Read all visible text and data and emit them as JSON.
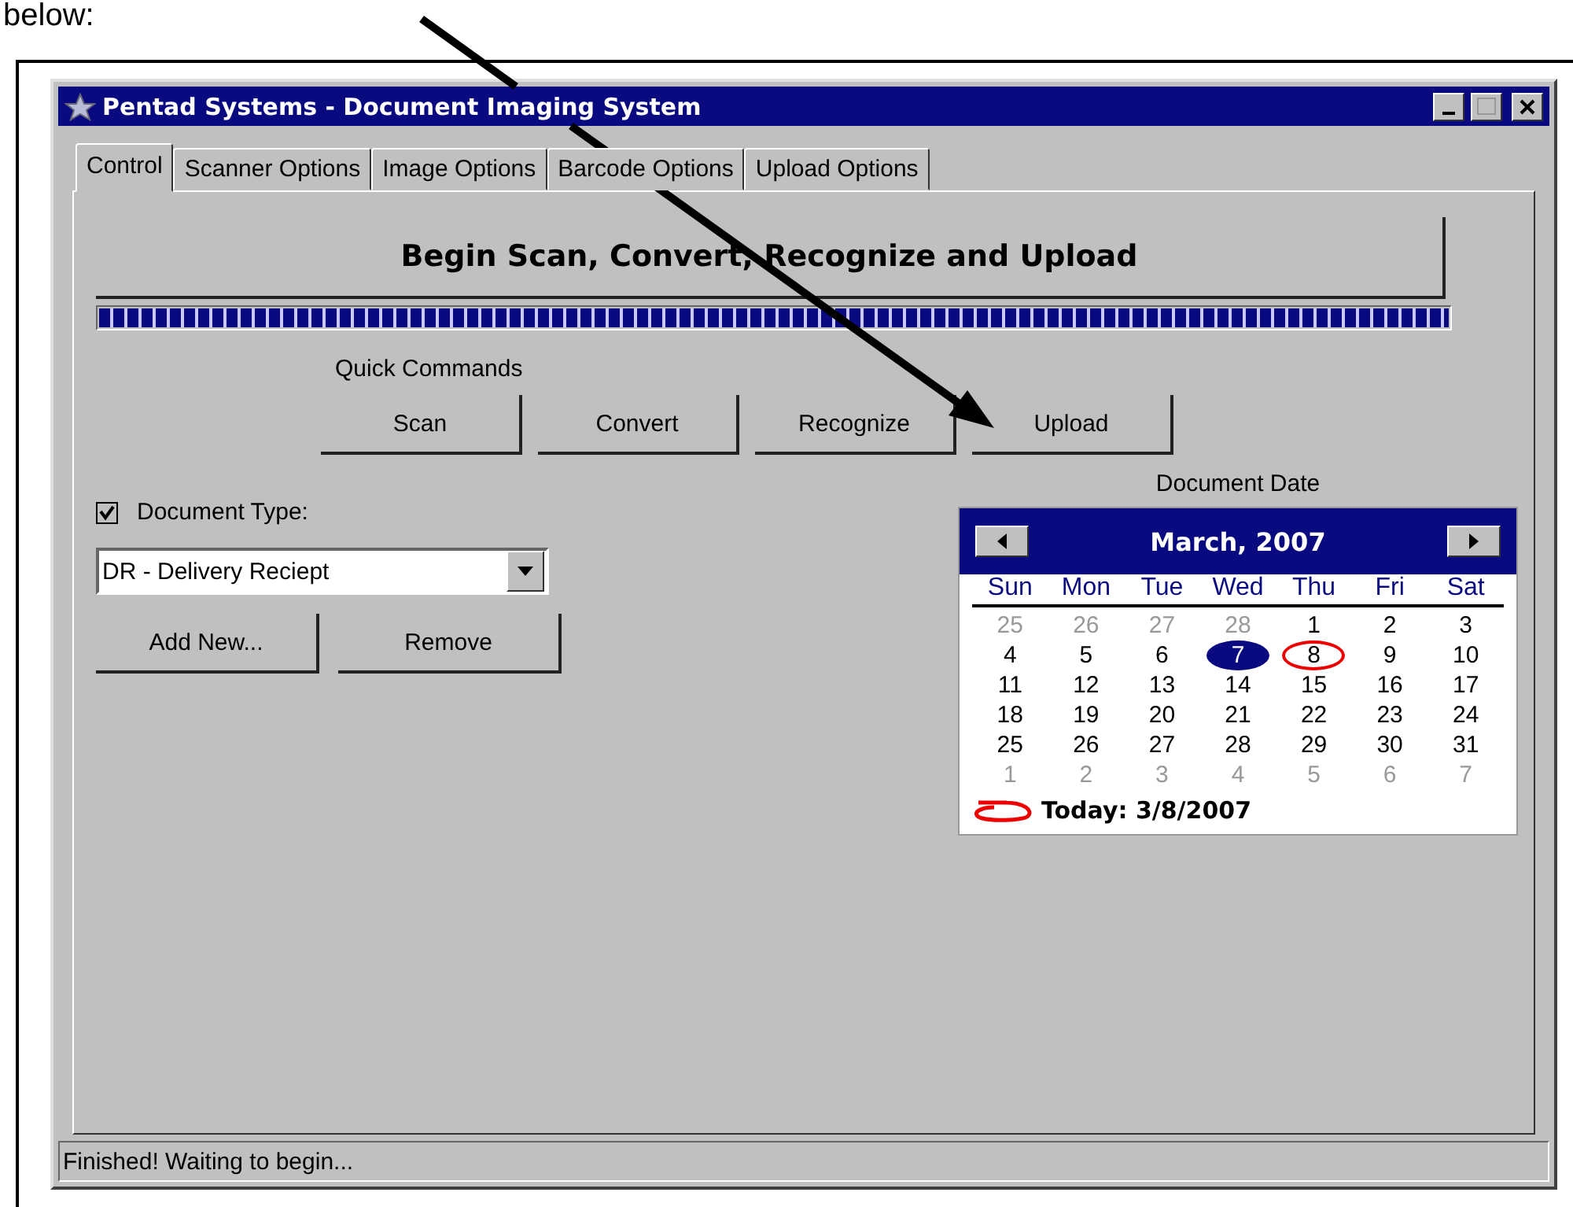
{
  "document_text": "below:",
  "window": {
    "title": "Pentad Systems - Document Imaging System"
  },
  "tabs": [
    {
      "label": "Control",
      "selected": true
    },
    {
      "label": "Scanner Options",
      "selected": false
    },
    {
      "label": "Image Options",
      "selected": false
    },
    {
      "label": "Barcode Options",
      "selected": false
    },
    {
      "label": "Upload Options",
      "selected": false
    }
  ],
  "main_button": "Begin Scan, Convert, Recognize and Upload",
  "progress": {
    "level": 1
  },
  "quick_commands": {
    "label": "Quick Commands",
    "buttons": [
      "Scan",
      "Convert",
      "Recognize",
      "Upload"
    ]
  },
  "document_type": {
    "label": "Document Type:",
    "checked": true,
    "value": "DR - Delivery Reciept",
    "buttons": [
      "Add New...",
      "Remove"
    ]
  },
  "document_date": {
    "label": "Document Date",
    "month": "March, 2007",
    "weekdays": [
      "Sun",
      "Mon",
      "Tue",
      "Wed",
      "Thu",
      "Fri",
      "Sat"
    ],
    "days": [
      {
        "text": "25",
        "muted": true,
        "selected": false,
        "today": false
      },
      {
        "text": "26",
        "muted": true,
        "selected": false,
        "today": false
      },
      {
        "text": "27",
        "muted": true,
        "selected": false,
        "today": false
      },
      {
        "text": "28",
        "muted": true,
        "selected": false,
        "today": false
      },
      {
        "text": "1",
        "muted": false,
        "selected": false,
        "today": false
      },
      {
        "text": "2",
        "muted": false,
        "selected": false,
        "today": false
      },
      {
        "text": "3",
        "muted": false,
        "selected": false,
        "today": false
      },
      {
        "text": "4",
        "muted": false,
        "selected": false,
        "today": false
      },
      {
        "text": "5",
        "muted": false,
        "selected": false,
        "today": false
      },
      {
        "text": "6",
        "muted": false,
        "selected": false,
        "today": false
      },
      {
        "text": "7",
        "muted": false,
        "selected": true,
        "today": false
      },
      {
        "text": "8",
        "muted": false,
        "selected": false,
        "today": true
      },
      {
        "text": "9",
        "muted": false,
        "selected": false,
        "today": false
      },
      {
        "text": "10",
        "muted": false,
        "selected": false,
        "today": false
      },
      {
        "text": "11",
        "muted": false,
        "selected": false,
        "today": false
      },
      {
        "text": "12",
        "muted": false,
        "selected": false,
        "today": false
      },
      {
        "text": "13",
        "muted": false,
        "selected": false,
        "today": false
      },
      {
        "text": "14",
        "muted": false,
        "selected": false,
        "today": false
      },
      {
        "text": "15",
        "muted": false,
        "selected": false,
        "today": false
      },
      {
        "text": "16",
        "muted": false,
        "selected": false,
        "today": false
      },
      {
        "text": "17",
        "muted": false,
        "selected": false,
        "today": false
      },
      {
        "text": "18",
        "muted": false,
        "selected": false,
        "today": false
      },
      {
        "text": "19",
        "muted": false,
        "selected": false,
        "today": false
      },
      {
        "text": "20",
        "muted": false,
        "selected": false,
        "today": false
      },
      {
        "text": "21",
        "muted": false,
        "selected": false,
        "today": false
      },
      {
        "text": "22",
        "muted": false,
        "selected": false,
        "today": false
      },
      {
        "text": "23",
        "muted": false,
        "selected": false,
        "today": false
      },
      {
        "text": "24",
        "muted": false,
        "selected": false,
        "today": false
      },
      {
        "text": "25",
        "muted": false,
        "selected": false,
        "today": false
      },
      {
        "text": "26",
        "muted": false,
        "selected": false,
        "today": false
      },
      {
        "text": "27",
        "muted": false,
        "selected": false,
        "today": false
      },
      {
        "text": "28",
        "muted": false,
        "selected": false,
        "today": false
      },
      {
        "text": "29",
        "muted": false,
        "selected": false,
        "today": false
      },
      {
        "text": "30",
        "muted": false,
        "selected": false,
        "today": false
      },
      {
        "text": "31",
        "muted": false,
        "selected": false,
        "today": false
      },
      {
        "text": "1",
        "muted": true,
        "selected": false,
        "today": false
      },
      {
        "text": "2",
        "muted": true,
        "selected": false,
        "today": false
      },
      {
        "text": "3",
        "muted": true,
        "selected": false,
        "today": false
      },
      {
        "text": "4",
        "muted": true,
        "selected": false,
        "today": false
      },
      {
        "text": "5",
        "muted": true,
        "selected": false,
        "today": false
      },
      {
        "text": "6",
        "muted": true,
        "selected": false,
        "today": false
      },
      {
        "text": "7",
        "muted": true,
        "selected": false,
        "today": false
      }
    ],
    "today_label": "Today: 3/8/2007"
  },
  "status_bar": "Finished! Waiting to begin..."
}
